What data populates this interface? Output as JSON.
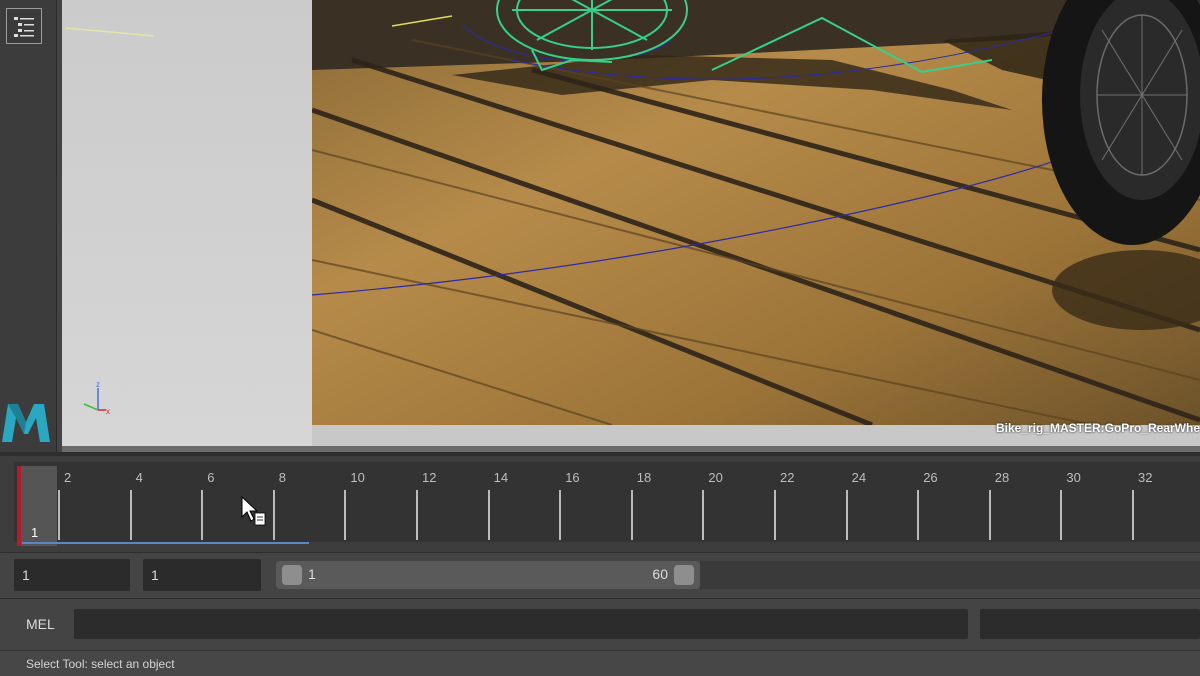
{
  "viewport": {
    "camera_label": "Bike_rig_MASTER:GoPro_RearWhe"
  },
  "timeline": {
    "frame_labels": [
      "2",
      "4",
      "6",
      "8",
      "10",
      "12",
      "14",
      "16",
      "18",
      "20",
      "22",
      "24",
      "26",
      "28",
      "30",
      "32"
    ],
    "current_frame": "1"
  },
  "range": {
    "start_field": "1",
    "playback_start_field": "1",
    "slider_start": "1",
    "slider_end": "60"
  },
  "command_line": {
    "language_label": "MEL",
    "input_value": ""
  },
  "help_line": {
    "text": "Select Tool: select an object"
  },
  "colors": {
    "current_frame_marker": "#b81a2c",
    "range_underline": "#5b87c5",
    "wireframe": "#37d08a"
  },
  "icons": {
    "outliner": "outliner-icon",
    "logo": "maya-logo",
    "axis": "axis-gizmo-icon",
    "cursor": "mouse-pointer-icon"
  }
}
